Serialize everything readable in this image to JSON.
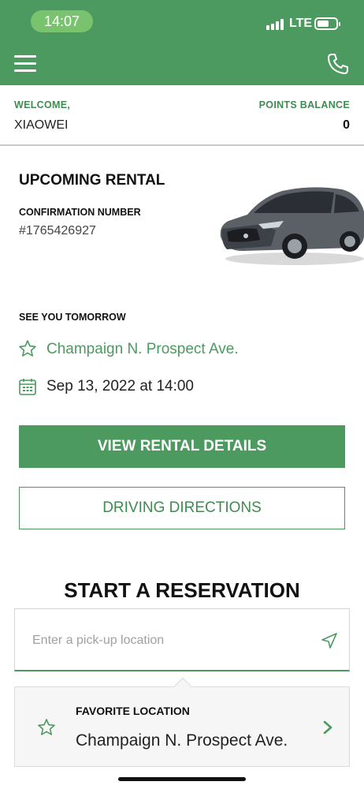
{
  "status_bar": {
    "time": "14:07",
    "network": "LTE"
  },
  "header": {
    "menu_icon": "hamburger-menu-icon",
    "phone_icon": "phone-icon"
  },
  "welcome": {
    "label": "WELCOME,",
    "name": "XIAOWEI"
  },
  "points": {
    "label": "POINTS BALANCE",
    "value": "0"
  },
  "upcoming_rental": {
    "title": "UPCOMING RENTAL",
    "confirmation_label": "CONFIRMATION NUMBER",
    "confirmation_number": "#1765426927",
    "see_you_label": "SEE YOU TOMORROW",
    "location": "Champaign N. Prospect Ave.",
    "datetime": "Sep 13, 2022 at 14:00",
    "view_details_label": "VIEW RENTAL DETAILS",
    "directions_label": "DRIVING DIRECTIONS"
  },
  "reservation": {
    "title": "START A RESERVATION",
    "pickup_placeholder": "Enter a pick-up location",
    "favorite_label": "FAVORITE LOCATION",
    "favorite_name": "Champaign N. Prospect Ave."
  },
  "colors": {
    "brand_green": "#4c9a5f",
    "pill_green": "#79c36f"
  }
}
